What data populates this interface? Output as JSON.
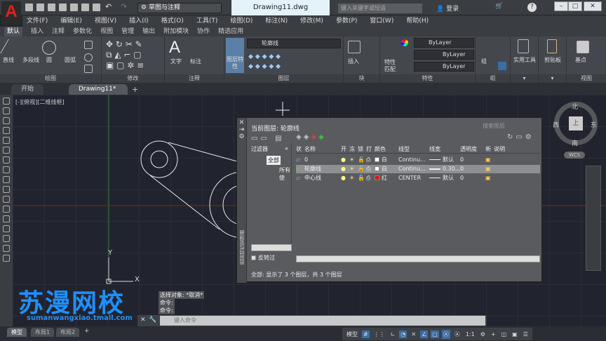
{
  "app": {
    "logo": "A",
    "workspace": "草图与注释",
    "document_title": "Drawing11.dwg",
    "search_placeholder": "键入关键字或短语",
    "login": "登录"
  },
  "menu": [
    "文件(F)",
    "编辑(E)",
    "视图(V)",
    "插入(I)",
    "格式(O)",
    "工具(T)",
    "绘图(D)",
    "标注(N)",
    "修改(M)",
    "参数(P)",
    "窗口(W)",
    "帮助(H)"
  ],
  "ribbon_tabs": [
    "默认",
    "插入",
    "注释",
    "参数化",
    "视图",
    "管理",
    "输出",
    "附加模块",
    "协作",
    "精选应用"
  ],
  "ribbon": {
    "draw": {
      "title": "绘图",
      "tools": [
        "直线",
        "多段线",
        "圆",
        "圆弧"
      ]
    },
    "modify": {
      "title": "修改"
    },
    "annotation": {
      "title": "注释",
      "tools": [
        "文字",
        "标注"
      ]
    },
    "layers": {
      "title": "图层",
      "layer_props": "图层特性",
      "current_layer": "轮廓线"
    },
    "block": {
      "title": "块",
      "insert": "插入"
    },
    "properties": {
      "title": "特性",
      "match": "特性匹配",
      "color": "ByLayer",
      "linetype": "ByLayer",
      "lineweight": "ByLayer"
    },
    "groups": {
      "title": "组",
      "group": "组"
    },
    "utilities": {
      "label": "实用工具"
    },
    "clipboard": {
      "label": "剪贴板"
    },
    "view": {
      "title": "视图",
      "basepoint": "基点"
    }
  },
  "file_tabs": [
    "开始",
    "Drawing11*"
  ],
  "viewport_label": "[-][俯视][二维线框]",
  "viewcube": {
    "north": "北",
    "south": "南",
    "east": "东",
    "west": "西",
    "top": "上",
    "wcs": "WCS"
  },
  "ucs": {
    "y": "Y",
    "x": "X"
  },
  "layer_palette": {
    "current": "当前图层: 轮廓线",
    "search_placeholder": "搜索图层",
    "filters_label": "过滤器",
    "filter_all": "全部",
    "filter_used": "所有使",
    "invert": "反转过",
    "side_title": "图层特性管理器",
    "columns": [
      "状",
      "名称",
      "开",
      "冻",
      "锁",
      "打",
      "颜色",
      "线型",
      "线宽",
      "透明度",
      "新",
      "说明"
    ],
    "layers": [
      {
        "name": "0",
        "color_name": "白",
        "color": "#ffffff",
        "linetype": "Continu...",
        "lineweight": "默认",
        "transparency": "0",
        "current": false,
        "selected": false
      },
      {
        "name": "轮廓线",
        "color_name": "白",
        "color": "#ffffff",
        "linetype": "Continu...",
        "lineweight": "0.30...",
        "transparency": "0",
        "current": true,
        "selected": true
      },
      {
        "name": "中心线",
        "color_name": "红",
        "color": "#ff0000",
        "linetype": "CENTER",
        "lineweight": "默认",
        "transparency": "0",
        "current": false,
        "selected": false
      }
    ],
    "status": "全部: 显示了 3 个图层，共 3 个图层"
  },
  "command": {
    "history": [
      "选择对象: *取消*",
      "命令:",
      "命令:"
    ],
    "placeholder": "键入命令"
  },
  "layout_tabs": [
    "模型",
    "布局1",
    "布局2"
  ],
  "status": {
    "model": "模型",
    "scale": "1:1"
  },
  "watermark": {
    "brand": "苏漫网校",
    "url": "sumanwangxiao.tmall.com"
  }
}
